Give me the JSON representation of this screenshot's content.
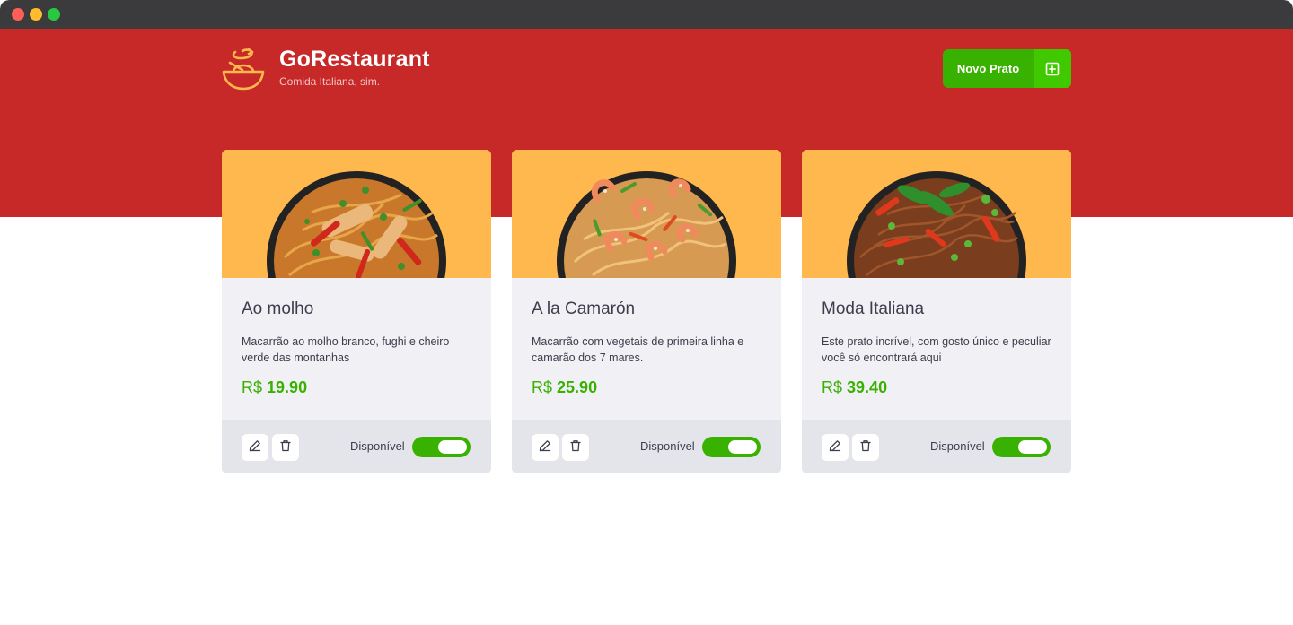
{
  "brand": {
    "title": "GoRestaurant",
    "subtitle": "Comida Italiana, sim."
  },
  "header": {
    "new_button_label": "Novo Prato"
  },
  "colors": {
    "header_red": "#c72828",
    "accent_green": "#39b100",
    "card_image_bg": "#ffb84d"
  },
  "foods": [
    {
      "name": "Ao molho",
      "description": "Macarrão ao molho branco, fughi e cheiro verde das montanhas",
      "currency": "R$",
      "price": "19.90",
      "available_label": "Disponível",
      "available": true,
      "image": "pasta-chicken"
    },
    {
      "name": "A la Camarón",
      "description": "Macarrão com vegetais de primeira linha e camarão dos 7 mares.",
      "currency": "R$",
      "price": "25.90",
      "available_label": "Disponível",
      "available": true,
      "image": "pasta-shrimp"
    },
    {
      "name": "Moda Italiana",
      "description": "Este prato incrível, com gosto único e peculiar você só encontrará aqui",
      "currency": "R$",
      "price": "39.40",
      "available_label": "Disponível",
      "available": true,
      "image": "pasta-vegetables"
    }
  ]
}
